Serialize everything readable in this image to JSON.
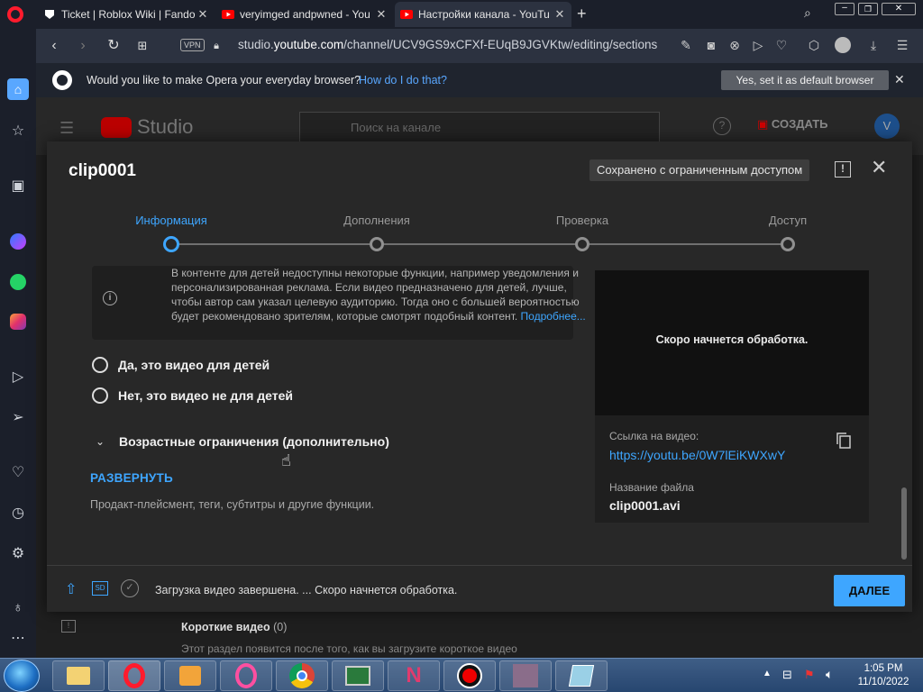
{
  "browser": {
    "tabs": [
      {
        "title": "Ticket | Roblox Wiki | Fando"
      },
      {
        "title": "veryimged andpwned - You"
      },
      {
        "title": "Настройки канала - YouTu"
      }
    ],
    "url_prefix": "studio.",
    "url_domain": "youtube.com",
    "url_path": "/channel/UCV9GS9xCFXf-EUqB9JGVKtw/editing/sections",
    "vpn_label": "VPN",
    "default_prompt": {
      "message": "Would you like to make Opera your everyday browser?",
      "how_link": "How do I do that?",
      "yes_button": "Yes, set it as default browser"
    }
  },
  "studio": {
    "logo_text": "Studio",
    "search_placeholder": "Поиск на канале",
    "create_label": "СОЗДАТЬ",
    "avatar_letter": "V"
  },
  "modal": {
    "title": "clip0001",
    "status": "Сохранено с ограниченным доступом",
    "steps": [
      "Информация",
      "Дополнения",
      "Проверка",
      "Доступ"
    ],
    "active_step": 0,
    "info_lines": [
      "В контенте для детей недоступны некоторые функции, например уведомления и",
      "персонализированная реклама. Если видео предназначено для детей, лучше,",
      "чтобы автор сам указал целевую аудиторию. Тогда оно с большей вероятностью",
      "будет рекомендовано зрителям, которые смотрят подобный контент."
    ],
    "info_more": "Подробнее...",
    "radio_yes": "Да, это видео для детей",
    "radio_no": "Нет, это видео не для детей",
    "age_restrictions": "Возрастные ограничения (дополнительно)",
    "expand_label": "РАЗВЕРНУТЬ",
    "expand_description": "Продакт-плейсмент, теги, субтитры и другие функции.",
    "preview_text": "Скоро начнется обработка.",
    "video_link_label": "Ссылка на видео:",
    "video_link": "https://youtu.be/0W7lEiKWXwY",
    "file_name_label": "Название файла",
    "file_name": "clip0001.avi",
    "footer_status": "Загрузка видео завершена. ... Скоро начнется обработка.",
    "sd_badge": "SD",
    "next_button": "ДАЛЕЕ"
  },
  "background": {
    "shorts_title": "Короткие видео",
    "shorts_count": "(0)",
    "shorts_description": "Этот раздел появится после того, как вы загрузите короткое видео"
  },
  "taskbar": {
    "time": "1:05 PM",
    "date": "11/10/2022"
  },
  "colors": {
    "accent": "#3ea6ff",
    "opera_red": "#ff1b2d",
    "youtube_red": "#ff0000"
  }
}
